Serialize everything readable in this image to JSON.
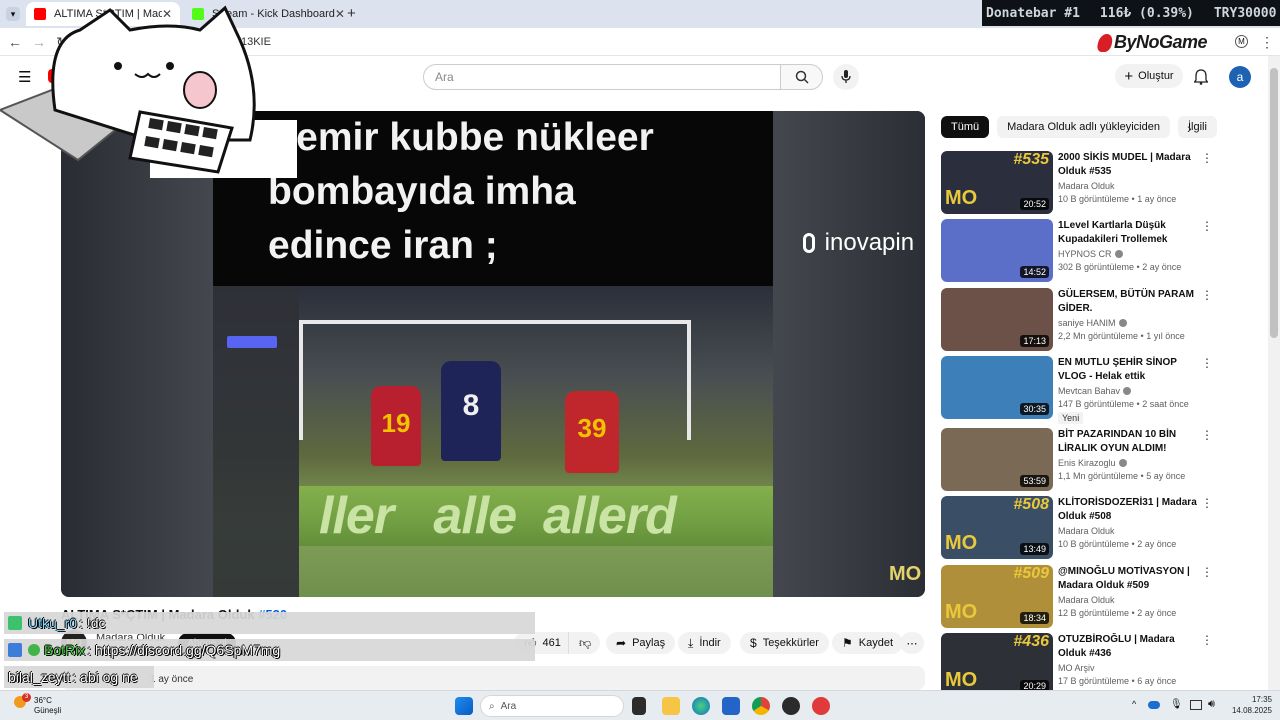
{
  "browser": {
    "tabs": [
      {
        "title": "ALTIMA S*ÇTIM | Madara",
        "active": true
      },
      {
        "title": "Stream - Kick Dashboard",
        "active": false
      }
    ],
    "new_tab": "+",
    "url": "NCnaoT13KIE"
  },
  "donatebar": {
    "label": "Donatebar #1",
    "amount": "116₺ (0.39%)",
    "target": "TRY30000"
  },
  "branding": {
    "name": "ByNoGame"
  },
  "youtube": {
    "search_placeholder": "Ara",
    "create_label": "Oluştur",
    "avatar_letter": "a"
  },
  "player": {
    "meme_text_lines": [
      "Demir kubbe nükleer",
      "bombayıda imha",
      "edince iran ;"
    ],
    "sponsor_logo": "inovapin",
    "watermark": "MO",
    "jersey_numbers": [
      "19",
      "8",
      "39"
    ]
  },
  "video": {
    "title_main": "ALTIMA S*ÇTIM | Madara Olduk ",
    "title_num": "#520",
    "channel": "Madara Olduk",
    "channel_avatar": "MO",
    "subscribe": "Abone ol",
    "likes": "461",
    "share": "Paylaş",
    "download": "İndir",
    "thanks": "Teşekkürler",
    "save": "Kaydet",
    "upload_age": "1 ay önce"
  },
  "chat": [
    {
      "user": "Utku_r0",
      "message": ": !dc",
      "badge_color": "#3cc26c"
    },
    {
      "user": "BotRix",
      "message": ": https://discord.gg/Q6SpM7mg",
      "badge_color": "#3c7dd9"
    },
    {
      "user": "bilal_zeytt",
      "message": ": abi og ne",
      "badge_color": ""
    }
  ],
  "sidebar": {
    "chips": [
      {
        "label": "Tümü",
        "active": true
      },
      {
        "label": "Madara Olduk adlı yükleyiciden",
        "active": false
      },
      {
        "label": "İlgili",
        "active": false
      }
    ],
    "recommendations": [
      {
        "title": "2000 SİKİS MUDEL | Madara Olduk #535",
        "channel": "Madara Olduk",
        "verified": false,
        "meta": "10 B görüntüleme • 1 ay önce",
        "duration": "20:52",
        "epnum": "#535",
        "mo": true,
        "thumb_color": "#2b2f3d",
        "badge": ""
      },
      {
        "title": "1Level Kartlarla Düşük Kupadakileri Trollemek",
        "channel": "HYPNOS CR",
        "verified": true,
        "meta": "302 B görüntüleme • 2 ay önce",
        "duration": "14:52",
        "epnum": "",
        "mo": false,
        "thumb_color": "#5b6fc9",
        "badge": ""
      },
      {
        "title": "GÜLERSEM, BÜTÜN PARAM GİDER.",
        "channel": "saniye HANIM",
        "verified": true,
        "meta": "2,2 Mn görüntüleme • 1 yıl önce",
        "duration": "17:13",
        "epnum": "",
        "mo": false,
        "thumb_color": "#6b5148",
        "badge": ""
      },
      {
        "title": "EN MUTLU ŞEHİR SİNOP VLOG - Helak ettik",
        "channel": "Mevtcan Bahav",
        "verified": true,
        "meta": "147 B görüntüleme • 2 saat önce",
        "duration": "30:35",
        "epnum": "",
        "mo": false,
        "thumb_color": "#3d7fb8",
        "badge": "Yeni"
      },
      {
        "title": "BİT PAZARINDAN 10 BİN LİRALIK OYUN ALDIM! (HEPSİ...",
        "channel": "Enis Kirazoglu",
        "verified": true,
        "meta": "1,1 Mn görüntüleme • 5 ay önce",
        "duration": "53:59",
        "epnum": "",
        "mo": false,
        "thumb_color": "#7a6a55",
        "badge": ""
      },
      {
        "title": "KLİTORİSDOZERİ31 | Madara Olduk #508",
        "channel": "Madara Olduk",
        "verified": false,
        "meta": "10 B görüntüleme • 2 ay önce",
        "duration": "13:49",
        "epnum": "#508",
        "mo": true,
        "thumb_color": "#3a4e66",
        "badge": ""
      },
      {
        "title": "@MINOĞLU MOTİVASYON | Madara Olduk #509",
        "channel": "Madara Olduk",
        "verified": false,
        "meta": "12 B görüntüleme • 2 ay önce",
        "duration": "18:34",
        "epnum": "#509",
        "mo": true,
        "thumb_color": "#b08f3a",
        "badge": ""
      },
      {
        "title": "OTUZBİROĞLU | Madara Olduk #436",
        "channel": "MO Arşiv",
        "verified": false,
        "meta": "17 B görüntüleme • 6 ay önce",
        "duration": "20:29",
        "epnum": "#436",
        "mo": true,
        "thumb_color": "#2e3038",
        "badge": ""
      }
    ]
  },
  "taskbar": {
    "weather_temp": "36°C",
    "weather_desc": "Güneşli",
    "weather_alert": "3",
    "search": "Ara",
    "time": "17:35",
    "date": "14.08.2025"
  },
  "colors": {
    "youtube_red": "#ff0000",
    "link_blue": "#065fd4",
    "mo_yellow": "#e9c83b"
  }
}
